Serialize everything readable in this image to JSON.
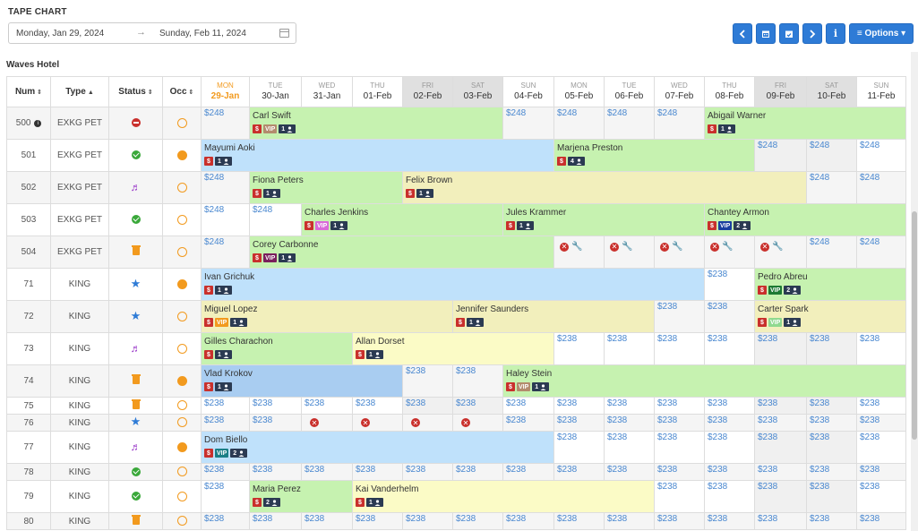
{
  "page": {
    "title": "TAPE CHART"
  },
  "date_range": {
    "from": "Monday, Jan 29, 2024",
    "arrow": "→",
    "to": "Sunday, Feb 11, 2024"
  },
  "toolbar": {
    "options_label": "≡ Options ▾"
  },
  "hotel": {
    "name": "Waves Hotel"
  },
  "columns": {
    "num": "Num",
    "type": "Type",
    "status": "Status",
    "occ": "Occ"
  },
  "days": [
    {
      "dow": "MON",
      "date": "29-Jan"
    },
    {
      "dow": "TUE",
      "date": "30-Jan"
    },
    {
      "dow": "WED",
      "date": "31-Jan"
    },
    {
      "dow": "THU",
      "date": "01-Feb"
    },
    {
      "dow": "FRI",
      "date": "02-Feb"
    },
    {
      "dow": "SAT",
      "date": "03-Feb"
    },
    {
      "dow": "SUN",
      "date": "04-Feb"
    },
    {
      "dow": "MON",
      "date": "05-Feb"
    },
    {
      "dow": "TUE",
      "date": "06-Feb"
    },
    {
      "dow": "WED",
      "date": "07-Feb"
    },
    {
      "dow": "THU",
      "date": "08-Feb"
    },
    {
      "dow": "FRI",
      "date": "09-Feb"
    },
    {
      "dow": "SAT",
      "date": "10-Feb"
    },
    {
      "dow": "SUN",
      "date": "11-Feb"
    }
  ],
  "rooms": [
    {
      "num": "500",
      "type": "EXKG PET",
      "status": "no-entry-icon",
      "occ": "empty",
      "rate": "$248",
      "cells": [
        {
          "p": 1
        },
        {
          "g": "Carl Swift",
          "span": 5,
          "c": "c-green",
          "vip": "VIP",
          "vc": "",
          "n": "1"
        },
        {
          "p": 1
        },
        {
          "p": 1
        },
        {
          "p": 1
        },
        {
          "p": 1
        },
        {
          "g": "Abigail Warner",
          "span": 4,
          "c": "c-green",
          "n": "1"
        }
      ]
    },
    {
      "num": "501",
      "type": "EXKG PET",
      "status": "check-icon",
      "occ": "full",
      "rate": "$248",
      "cells": [
        {
          "g": "Mayumi Aoki",
          "span": 7,
          "c": "c-blue",
          "n": "1"
        },
        {
          "g": "Marjena Preston",
          "span": 4,
          "c": "c-green",
          "n": "4"
        },
        {
          "p": 1
        },
        {
          "p": 1
        },
        {
          "p": 1
        }
      ]
    },
    {
      "num": "502",
      "type": "EXKG PET",
      "status": "music-icon",
      "occ": "empty",
      "rate": "$248",
      "cells": [
        {
          "p": 1
        },
        {
          "g": "Fiona Peters",
          "span": 3,
          "c": "c-green",
          "n": "1"
        },
        {
          "g": "Felix Brown",
          "span": 8,
          "c": "c-yellow",
          "n": "1"
        },
        {
          "p": 1
        },
        {
          "p": 1
        }
      ]
    },
    {
      "num": "503",
      "type": "EXKG PET",
      "status": "check-icon",
      "occ": "empty",
      "rate": "$248",
      "cells": [
        {
          "p": 1
        },
        {
          "p": 1
        },
        {
          "g": "Charles Jenkins",
          "span": 4,
          "c": "c-green",
          "vip": "VIP",
          "vc": "pink",
          "n": "1"
        },
        {
          "g": "Jules Krammer",
          "span": 4,
          "c": "c-green",
          "n": "1"
        },
        {
          "g": "Chantey Armon",
          "span": 4,
          "c": "c-green",
          "vip": "VIP",
          "vc": "navy",
          "n": "2"
        }
      ]
    },
    {
      "num": "504",
      "type": "EXKG PET",
      "status": "trash-icon",
      "occ": "empty",
      "rate": "$248",
      "cells": [
        {
          "p": 1
        },
        {
          "g": "Corey Carbonne",
          "span": 6,
          "c": "c-green",
          "vip": "VIP",
          "vc": "dark",
          "n": "1"
        },
        {
          "b": 1
        },
        {
          "b": 1
        },
        {
          "b": 1
        },
        {
          "b": 1
        },
        {
          "b": 1
        },
        {
          "p": 1
        },
        {
          "p": 1
        }
      ]
    },
    {
      "num": "71",
      "type": "KING",
      "status": "star-icon",
      "occ": "full",
      "rate": "$238",
      "cells": [
        {
          "g": "Ivan Grichuk",
          "span": 10,
          "c": "c-blue",
          "n": "1"
        },
        {
          "p": 1
        },
        {
          "g": "Pedro Abreu",
          "span": 3,
          "c": "c-green",
          "vip": "VIP",
          "vc": "green",
          "n": "2"
        }
      ]
    },
    {
      "num": "72",
      "type": "KING",
      "status": "star-icon",
      "occ": "empty",
      "rate": "$238",
      "cells": [
        {
          "g": "Miguel Lopez",
          "span": 5,
          "c": "c-yellow",
          "vip": "VIP",
          "vc": "orange",
          "n": "1"
        },
        {
          "g": "Jennifer Saunders",
          "span": 4,
          "c": "c-yellow",
          "n": "1"
        },
        {
          "p": 1
        },
        {
          "p": 1
        },
        {
          "g": "Carter Spark",
          "span": 3,
          "c": "c-yellow",
          "vip": "VIP",
          "vc": "lime",
          "n": "1"
        }
      ]
    },
    {
      "num": "73",
      "type": "KING",
      "status": "music-icon",
      "occ": "empty",
      "rate": "$238",
      "cells": [
        {
          "g": "Gilles Charachon",
          "span": 3,
          "c": "c-green",
          "n": "1"
        },
        {
          "g": "Allan Dorset",
          "span": 4,
          "c": "c-lyellow",
          "n": "1"
        },
        {
          "p": 1
        },
        {
          "p": 1
        },
        {
          "p": 1
        },
        {
          "p": 1
        },
        {
          "p": 1
        },
        {
          "p": 1
        },
        {
          "p": 1
        }
      ]
    },
    {
      "num": "74",
      "type": "KING",
      "status": "trash-icon",
      "occ": "full",
      "rate": "$238",
      "cells": [
        {
          "g": "Vlad Krokov",
          "span": 4,
          "c": "c-dblue",
          "n": "1"
        },
        {
          "p": 1
        },
        {
          "p": 1
        },
        {
          "g": "Haley Stein",
          "span": 8,
          "c": "c-green",
          "vip": "VIP",
          "vc": "",
          "n": "1"
        }
      ]
    },
    {
      "num": "75",
      "type": "KING",
      "status": "trash-icon",
      "occ": "empty",
      "rate": "$238",
      "cells": [
        {
          "p": 1
        },
        {
          "p": 1
        },
        {
          "p": 1
        },
        {
          "p": 1
        },
        {
          "p": 1
        },
        {
          "p": 1
        },
        {
          "p": 1
        },
        {
          "p": 1
        },
        {
          "p": 1
        },
        {
          "p": 1
        },
        {
          "p": 1
        },
        {
          "p": 1
        },
        {
          "p": 1
        },
        {
          "p": 1
        }
      ]
    },
    {
      "num": "76",
      "type": "KING",
      "status": "star-icon",
      "occ": "empty",
      "rate": "$238",
      "cells": [
        {
          "p": 1
        },
        {
          "p": 1
        },
        {
          "x": 1
        },
        {
          "x": 1
        },
        {
          "x": 1
        },
        {
          "x": 1
        },
        {
          "p": 1
        },
        {
          "p": 1
        },
        {
          "p": 1
        },
        {
          "p": 1
        },
        {
          "p": 1
        },
        {
          "p": 1
        },
        {
          "p": 1
        },
        {
          "p": 1
        }
      ]
    },
    {
      "num": "77",
      "type": "KING",
      "status": "music-icon",
      "occ": "full",
      "rate": "$238",
      "cells": [
        {
          "g": "Dom Biello",
          "span": 7,
          "c": "c-blue",
          "vip": "VIP",
          "vc": "teal",
          "n": "2"
        },
        {
          "p": 1
        },
        {
          "p": 1
        },
        {
          "p": 1
        },
        {
          "p": 1
        },
        {
          "p": 1
        },
        {
          "p": 1
        },
        {
          "p": 1
        }
      ]
    },
    {
      "num": "78",
      "type": "KING",
      "status": "check-icon",
      "occ": "empty",
      "rate": "$238",
      "cells": [
        {
          "p": 1
        },
        {
          "p": 1
        },
        {
          "p": 1
        },
        {
          "p": 1
        },
        {
          "p": 1
        },
        {
          "p": 1
        },
        {
          "p": 1
        },
        {
          "p": 1
        },
        {
          "p": 1
        },
        {
          "p": 1
        },
        {
          "p": 1
        },
        {
          "p": 1
        },
        {
          "p": 1
        },
        {
          "p": 1
        }
      ]
    },
    {
      "num": "79",
      "type": "KING",
      "status": "check-icon",
      "occ": "empty",
      "rate": "$238",
      "cells": [
        {
          "p": 1
        },
        {
          "g": "Maria Perez",
          "span": 2,
          "c": "c-green",
          "n": "2"
        },
        {
          "g": "Kai Vanderhelm",
          "span": 6,
          "c": "c-lyellow",
          "n": "1"
        },
        {
          "p": 1
        },
        {
          "p": 1
        },
        {
          "p": 1
        },
        {
          "p": 1
        },
        {
          "p": 1
        }
      ]
    },
    {
      "num": "80",
      "type": "KING",
      "status": "trash-icon",
      "occ": "empty",
      "rate": "$238",
      "cells": [
        {
          "p": 1
        },
        {
          "p": 1
        },
        {
          "p": 1
        },
        {
          "p": 1
        },
        {
          "p": 1
        },
        {
          "p": 1
        },
        {
          "p": 1
        },
        {
          "p": 1
        },
        {
          "p": 1
        },
        {
          "p": 1
        },
        {
          "p": 1
        },
        {
          "p": 1
        },
        {
          "p": 1
        },
        {
          "p": 1
        }
      ]
    }
  ],
  "colors": {
    "accent": "#2e7bd6",
    "today": "#f29a1e",
    "price": "#4a88d0",
    "danger": "#c9302c"
  }
}
